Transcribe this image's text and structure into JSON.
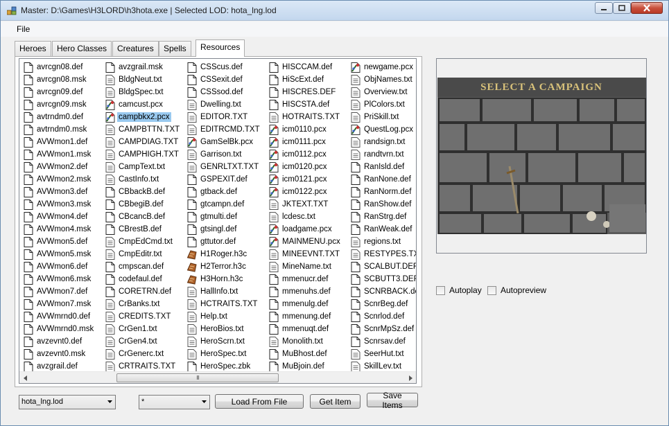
{
  "window": {
    "title": "Master: D:\\Games\\H3LORD\\h3hota.exe | Selected LOD: hota_lng.lod"
  },
  "menu": {
    "file": "File"
  },
  "tabs": [
    {
      "label": "Heroes",
      "active": false
    },
    {
      "label": "Hero Classes",
      "active": false
    },
    {
      "label": "Creatures",
      "active": false
    },
    {
      "label": "Spells",
      "active": false
    },
    {
      "label": "Resources",
      "active": true
    }
  ],
  "files": {
    "columns": [
      [
        {
          "name": "avrcgn08.def",
          "icon": "file-icon"
        },
        {
          "name": "avrcgn08.msk",
          "icon": "file-icon"
        },
        {
          "name": "avrcgn09.def",
          "icon": "file-icon"
        },
        {
          "name": "avrcgn09.msk",
          "icon": "file-icon"
        },
        {
          "name": "avtrndm0.def",
          "icon": "file-icon"
        },
        {
          "name": "avtrndm0.msk",
          "icon": "file-icon"
        },
        {
          "name": "AVWmon1.def",
          "icon": "file-icon"
        },
        {
          "name": "AVWmon1.msk",
          "icon": "file-icon"
        },
        {
          "name": "AVWmon2.def",
          "icon": "file-icon"
        },
        {
          "name": "AVWmon2.msk",
          "icon": "file-icon"
        },
        {
          "name": "AVWmon3.def",
          "icon": "file-icon"
        },
        {
          "name": "AVWmon3.msk",
          "icon": "file-icon"
        },
        {
          "name": "AVWmon4.def",
          "icon": "file-icon"
        },
        {
          "name": "AVWmon4.msk",
          "icon": "file-icon"
        },
        {
          "name": "AVWmon5.def",
          "icon": "file-icon"
        },
        {
          "name": "AVWmon5.msk",
          "icon": "file-icon"
        },
        {
          "name": "AVWmon6.def",
          "icon": "file-icon"
        },
        {
          "name": "AVWmon6.msk",
          "icon": "file-icon"
        },
        {
          "name": "AVWmon7.def",
          "icon": "file-icon"
        },
        {
          "name": "AVWmon7.msk",
          "icon": "file-icon"
        },
        {
          "name": "AVWmrnd0.def",
          "icon": "file-icon"
        },
        {
          "name": "AVWmrnd0.msk",
          "icon": "file-icon"
        },
        {
          "name": "avzevnt0.def",
          "icon": "file-icon"
        },
        {
          "name": "avzevnt0.msk",
          "icon": "file-icon"
        },
        {
          "name": "avzgrail.def",
          "icon": "file-icon"
        }
      ],
      [
        {
          "name": "avzgrail.msk",
          "icon": "file-icon"
        },
        {
          "name": "BldgNeut.txt",
          "icon": "text-file-icon"
        },
        {
          "name": "BldgSpec.txt",
          "icon": "text-file-icon"
        },
        {
          "name": "camcust.pcx",
          "icon": "image-file-icon"
        },
        {
          "name": "campbkx2.pcx",
          "icon": "image-file-icon",
          "selected": true
        },
        {
          "name": "CAMPBTTN.TXT",
          "icon": "text-file-icon"
        },
        {
          "name": "CAMPDIAG.TXT",
          "icon": "text-file-icon"
        },
        {
          "name": "CAMPHIGH.TXT",
          "icon": "text-file-icon"
        },
        {
          "name": "CampText.txt",
          "icon": "text-file-icon"
        },
        {
          "name": "CastInfo.txt",
          "icon": "text-file-icon"
        },
        {
          "name": "CBbackB.def",
          "icon": "file-icon"
        },
        {
          "name": "CBbegiB.def",
          "icon": "file-icon"
        },
        {
          "name": "CBcancB.def",
          "icon": "file-icon"
        },
        {
          "name": "CBrestB.def",
          "icon": "file-icon"
        },
        {
          "name": "CmpEdCmd.txt",
          "icon": "text-file-icon"
        },
        {
          "name": "CmpEditr.txt",
          "icon": "text-file-icon"
        },
        {
          "name": "cmpscan.def",
          "icon": "file-icon"
        },
        {
          "name": "codefaul.def",
          "icon": "file-icon"
        },
        {
          "name": "CORETRN.def",
          "icon": "file-icon"
        },
        {
          "name": "CrBanks.txt",
          "icon": "text-file-icon"
        },
        {
          "name": "CREDITS.TXT",
          "icon": "text-file-icon"
        },
        {
          "name": "CrGen1.txt",
          "icon": "text-file-icon"
        },
        {
          "name": "CrGen4.txt",
          "icon": "text-file-icon"
        },
        {
          "name": "CrGenerc.txt",
          "icon": "text-file-icon"
        },
        {
          "name": "CRTRAITS.TXT",
          "icon": "text-file-icon"
        }
      ],
      [
        {
          "name": "CSScus.def",
          "icon": "file-icon"
        },
        {
          "name": "CSSexit.def",
          "icon": "file-icon"
        },
        {
          "name": "CSSsod.def",
          "icon": "file-icon"
        },
        {
          "name": "Dwelling.txt",
          "icon": "text-file-icon"
        },
        {
          "name": "EDITOR.TXT",
          "icon": "text-file-icon"
        },
        {
          "name": "EDITRCMD.TXT",
          "icon": "text-file-icon"
        },
        {
          "name": "GamSelBk.pcx",
          "icon": "image-file-icon"
        },
        {
          "name": "Garrison.txt",
          "icon": "text-file-icon"
        },
        {
          "name": "GENRLTXT.TXT",
          "icon": "text-file-icon"
        },
        {
          "name": "GSPEXIT.def",
          "icon": "file-icon"
        },
        {
          "name": "gtback.def",
          "icon": "file-icon"
        },
        {
          "name": "gtcampn.def",
          "icon": "file-icon"
        },
        {
          "name": "gtmulti.def",
          "icon": "file-icon"
        },
        {
          "name": "gtsingl.def",
          "icon": "file-icon"
        },
        {
          "name": "gttutor.def",
          "icon": "file-icon"
        },
        {
          "name": "H1Roger.h3c",
          "icon": "campaign-file-icon"
        },
        {
          "name": "H2Terror.h3c",
          "icon": "campaign-file-icon"
        },
        {
          "name": "H3Horn.h3c",
          "icon": "campaign-file-icon"
        },
        {
          "name": "HallInfo.txt",
          "icon": "text-file-icon"
        },
        {
          "name": "HCTRAITS.TXT",
          "icon": "text-file-icon"
        },
        {
          "name": "Help.txt",
          "icon": "text-file-icon"
        },
        {
          "name": "HeroBios.txt",
          "icon": "text-file-icon"
        },
        {
          "name": "HeroScrn.txt",
          "icon": "text-file-icon"
        },
        {
          "name": "HeroSpec.txt",
          "icon": "text-file-icon"
        },
        {
          "name": "HeroSpec.zbk",
          "icon": "file-icon"
        }
      ],
      [
        {
          "name": "HISCCAM.def",
          "icon": "file-icon"
        },
        {
          "name": "HiScExt.def",
          "icon": "file-icon"
        },
        {
          "name": "HISCRES.DEF",
          "icon": "file-icon"
        },
        {
          "name": "HISCSTA.def",
          "icon": "file-icon"
        },
        {
          "name": "HOTRAITS.TXT",
          "icon": "text-file-icon"
        },
        {
          "name": "icm0110.pcx",
          "icon": "image-file-icon"
        },
        {
          "name": "icm0111.pcx",
          "icon": "image-file-icon"
        },
        {
          "name": "icm0112.pcx",
          "icon": "image-file-icon"
        },
        {
          "name": "icm0120.pcx",
          "icon": "image-file-icon"
        },
        {
          "name": "icm0121.pcx",
          "icon": "image-file-icon"
        },
        {
          "name": "icm0122.pcx",
          "icon": "image-file-icon"
        },
        {
          "name": "JKTEXT.TXT",
          "icon": "text-file-icon"
        },
        {
          "name": "lcdesc.txt",
          "icon": "text-file-icon"
        },
        {
          "name": "loadgame.pcx",
          "icon": "image-file-icon"
        },
        {
          "name": "MAINMENU.pcx",
          "icon": "image-file-icon"
        },
        {
          "name": "MINEEVNT.TXT",
          "icon": "text-file-icon"
        },
        {
          "name": "MineName.txt",
          "icon": "text-file-icon"
        },
        {
          "name": "mmenucr.def",
          "icon": "file-icon"
        },
        {
          "name": "mmenuhs.def",
          "icon": "file-icon"
        },
        {
          "name": "mmenulg.def",
          "icon": "file-icon"
        },
        {
          "name": "mmenung.def",
          "icon": "file-icon"
        },
        {
          "name": "mmenuqt.def",
          "icon": "file-icon"
        },
        {
          "name": "Monolith.txt",
          "icon": "text-file-icon"
        },
        {
          "name": "MuBhost.def",
          "icon": "file-icon"
        },
        {
          "name": "MuBjoin.def",
          "icon": "file-icon"
        }
      ],
      [
        {
          "name": "newgame.pcx",
          "icon": "image-file-icon"
        },
        {
          "name": "ObjNames.txt",
          "icon": "text-file-icon"
        },
        {
          "name": "Overview.txt",
          "icon": "text-file-icon"
        },
        {
          "name": "PlColors.txt",
          "icon": "text-file-icon"
        },
        {
          "name": "PriSkill.txt",
          "icon": "text-file-icon"
        },
        {
          "name": "QuestLog.pcx",
          "icon": "image-file-icon"
        },
        {
          "name": "randsign.txt",
          "icon": "text-file-icon"
        },
        {
          "name": "randtvrn.txt",
          "icon": "text-file-icon"
        },
        {
          "name": "RanIsld.def",
          "icon": "file-icon"
        },
        {
          "name": "RanNone.def",
          "icon": "file-icon"
        },
        {
          "name": "RanNorm.def",
          "icon": "file-icon"
        },
        {
          "name": "RanShow.def",
          "icon": "file-icon"
        },
        {
          "name": "RanStrg.def",
          "icon": "file-icon"
        },
        {
          "name": "RanWeak.def",
          "icon": "file-icon"
        },
        {
          "name": "regions.txt",
          "icon": "text-file-icon"
        },
        {
          "name": "RESTYPES.TXT",
          "icon": "text-file-icon"
        },
        {
          "name": "SCALBUT.DEF",
          "icon": "file-icon"
        },
        {
          "name": "SCBUTT3.DEF",
          "icon": "file-icon"
        },
        {
          "name": "SCNRBACK.def",
          "icon": "file-icon"
        },
        {
          "name": "ScnrBeg.def",
          "icon": "file-icon"
        },
        {
          "name": "Scnrlod.def",
          "icon": "file-icon"
        },
        {
          "name": "ScnrMpSz.def",
          "icon": "file-icon"
        },
        {
          "name": "Scnrsav.def",
          "icon": "file-icon"
        },
        {
          "name": "SeerHut.txt",
          "icon": "text-file-icon"
        },
        {
          "name": "SkillLev.txt",
          "icon": "text-file-icon"
        }
      ]
    ],
    "scrollbar_grip": "III"
  },
  "preview": {
    "banner": "SELECT A CAMPAIGN"
  },
  "options": {
    "autoplay": "Autoplay",
    "autopreview": "Autopreview"
  },
  "controls": {
    "lod_select": "hota_lng.lod",
    "filter_select": "*",
    "load_button": "Load From File",
    "get_button": "Get Item",
    "save_button": "Save Items"
  },
  "colors": {
    "selection": "#99c9ef",
    "stone": "#5e5e5e",
    "banner": "#d9c27a"
  }
}
